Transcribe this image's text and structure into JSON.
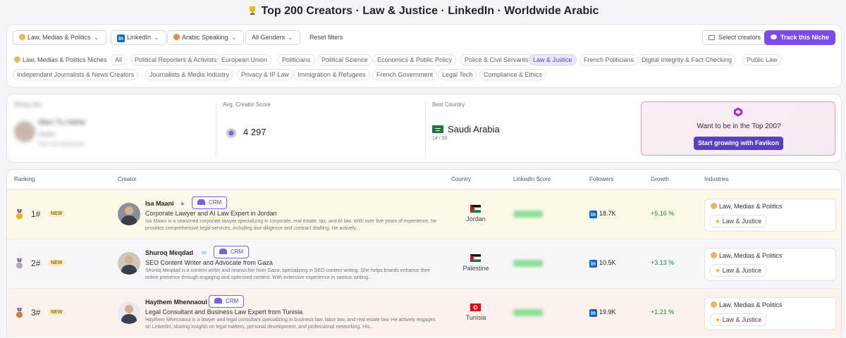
{
  "page": {
    "title": "Top 200 Creators · Law & Justice · LinkedIn · Worldwide Arabic"
  },
  "filters": {
    "niche": "Law, Medias & Politics",
    "platform": "LinkedIn",
    "language": "Arabic Speaking",
    "gender": "All Genders",
    "reset": "Reset filters",
    "select": "Select creators",
    "track": "Track this Niche"
  },
  "niches": {
    "heading": "Law, Medias & Politics Niches",
    "row1": [
      "All",
      "Political Reporters & Activists",
      "European Union",
      "Politicians",
      "Political Science",
      "Economics & Public Policy",
      "Police & Civil Servants",
      "Law & Justice",
      "French Politicians",
      "Digital Integrity & Fact Checking",
      "Public Law"
    ],
    "row2": [
      "Independant Journalists & News Creators",
      "Journalists & Media Industry",
      "Privacy & IP Law",
      "Immigration & Refugees",
      "French Government",
      "Legal Tech",
      "Compliance & Ethics"
    ],
    "active": "Law & Justice"
  },
  "stats": {
    "rising_label": "Rising Star",
    "rising_name": "Wen Tu Hehe",
    "rising_sub": "Jordan",
    "rising_meta": "Tech & Employees",
    "avg_label": "Avg. Creator Score",
    "avg_value": "4 297",
    "best_label": "Best Country",
    "best_country": "Saudi Arabia",
    "best_sub": "14 / 50"
  },
  "promo": {
    "text": "Want to be in the Top 200?",
    "button": "Start growing with Favikon"
  },
  "table": {
    "headers": [
      "Ranking",
      "Creator",
      "Country",
      "LinkedIn Score",
      "Followers",
      "Growth",
      "Industries"
    ],
    "rows": [
      {
        "rank": "1#",
        "badge": "NEW",
        "name": "Isa Maani",
        "crm": "CRM",
        "headline": "Corporate Lawyer and AI Law Expert in Jordan",
        "desc": "Isa Maani is a seasoned corporate lawyer specializing in corporate, real estate, tax, and AI law. With over five years of experience, he provides comprehensive legal services, including due diligence and contract drafting. He actively...",
        "country": "Jordan",
        "followers": "18.7K",
        "growth": "+5.16 %",
        "industry": "Law, Medias & Politics",
        "sub_industry": "Law & Justice"
      },
      {
        "rank": "2#",
        "badge": "NEW",
        "name": "Shuroq Meqdad",
        "crm": "CRM",
        "headline": "SEO Content Writer and Advocate from Gaza",
        "desc": "Shuroq Meqdad is a content writer and researcher from Gaza, specializing in SEO content writing. She helps brands enhance their online presence through engaging and optimized content. With extensive experience in various writing...",
        "country": "Palestine",
        "followers": "10.5K",
        "growth": "+3.13 %",
        "industry": "Law, Medias & Politics",
        "sub_industry": "Law & Justice"
      },
      {
        "rank": "3#",
        "badge": "NEW",
        "name": "Haythem Mhennaoui",
        "crm": "CRM",
        "headline": "Legal Consultant and Business Law Expert from Tunisia",
        "desc": "Haythem Mhennaoui is a lawyer and legal consultant specializing in business law, labor law, and real estate law. He actively engages on LinkedIn, sharing insights on legal matters, personal development, and professional networking. His...",
        "country": "Tunisia",
        "followers": "19.9K",
        "growth": "+1.21 %",
        "industry": "Law, Medias & Politics",
        "sub_industry": "Law & Justice"
      }
    ]
  },
  "colors": {
    "accent": "#7b4ce8",
    "growth": "#1a8a3a",
    "linkedin": "#0a66c2"
  },
  "icons": [
    "trophy-icon",
    "linkedin-icon",
    "chevron-down-icon",
    "eye-icon",
    "select-icon",
    "favikon-icon",
    "gold-medal-icon",
    "silver-medal-icon",
    "bronze-medal-icon",
    "crm-icon",
    "star-icon"
  ]
}
